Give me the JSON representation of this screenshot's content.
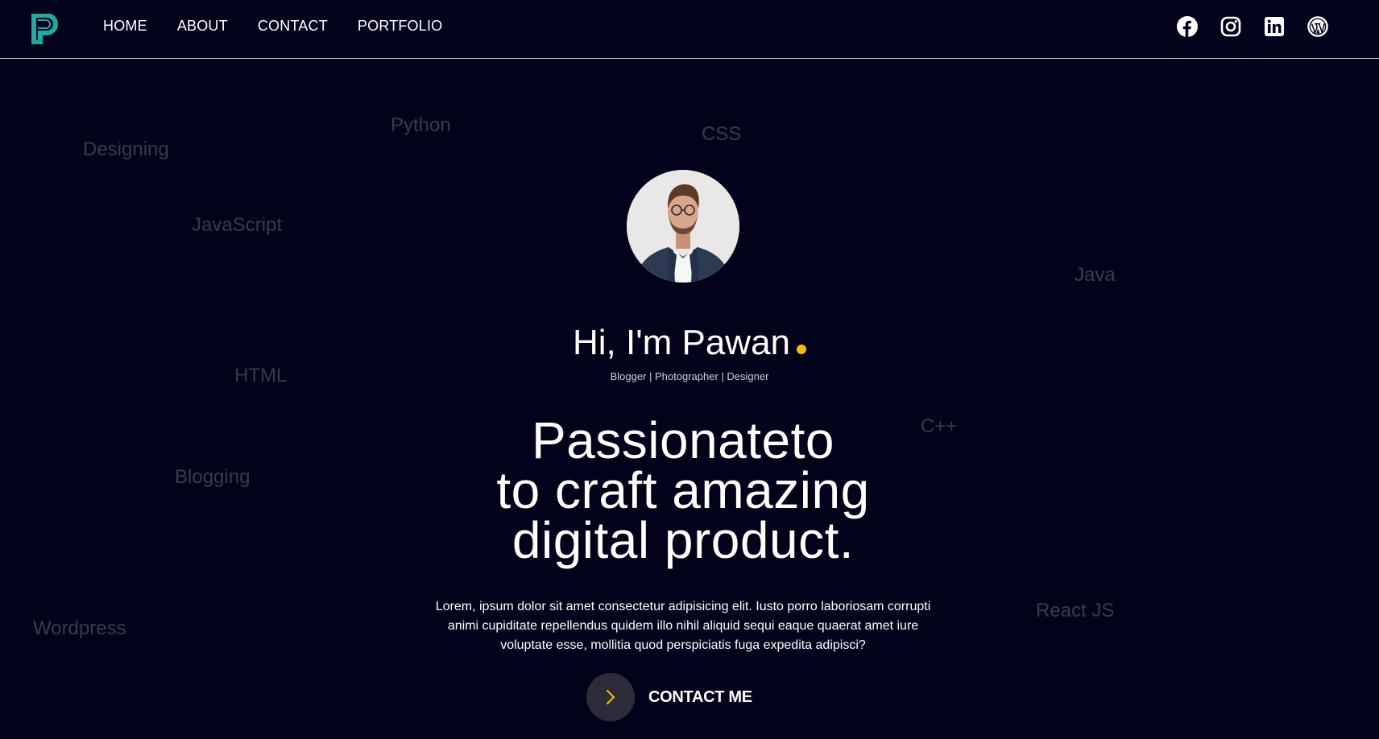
{
  "nav": {
    "links": [
      "HOME",
      "ABOUT",
      "CONTACT",
      "PORTFOLIO"
    ]
  },
  "socials": [
    {
      "icon": "facebook-icon"
    },
    {
      "icon": "instagram-icon"
    },
    {
      "icon": "linkedin-icon"
    },
    {
      "icon": "wordpress-icon"
    }
  ],
  "skills": [
    "Designing",
    "Python",
    "CSS",
    "JavaScript",
    "Java",
    "HTML",
    "C++",
    "Blogging",
    "Wordpress",
    "React JS"
  ],
  "hero": {
    "greeting": "Hi, I'm Pawan",
    "subtitle": "Blogger | Photographer | Designer",
    "headline": [
      "Passionateto",
      "to craft amazing",
      "digital product."
    ],
    "description": "Lorem, ipsum dolor sit amet consectetur adipisicing elit. Iusto porro laboriosam corrupti animi cupiditate repellendus quidem illo nihil aliquid sequi eaque quaerat amet iure voluptate esse, mollitia quod perspiciatis fuga expedita adipisci?",
    "cta_label": "CONTACT ME"
  },
  "colors": {
    "background": "#02021a",
    "accent_dot": "#f5b80f",
    "logo": "#1fa9a0",
    "skill_text": "#3a3a4e",
    "cta_circle": "#2b2b3a"
  }
}
